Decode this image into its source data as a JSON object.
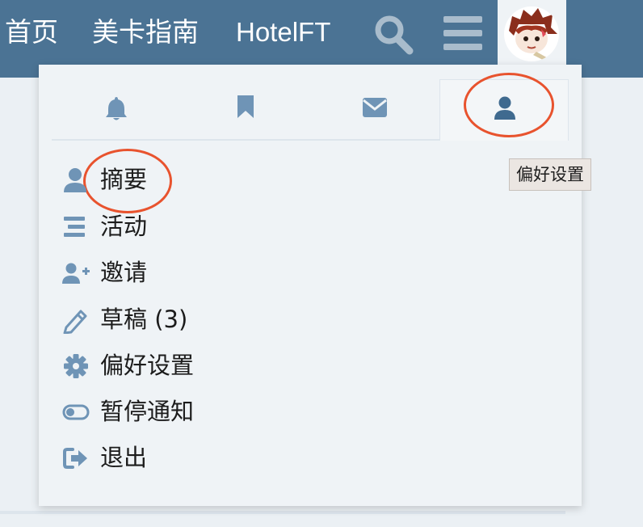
{
  "colors": {
    "header_bg": "#4b7394",
    "panel_bg": "#eff3f6",
    "icon_color": "#6f94b6",
    "active_icon_color": "#3f6a8f",
    "annotation_red": "#e8532e"
  },
  "header": {
    "nav_links": [
      {
        "label": "首页"
      },
      {
        "label": "美卡指南"
      },
      {
        "label": "HotelFT"
      }
    ],
    "icons": [
      "search-icon",
      "hamburger-menu-icon",
      "user-avatar"
    ]
  },
  "user_menu": {
    "tabs": [
      {
        "icon": "bell-icon",
        "active": false
      },
      {
        "icon": "bookmark-icon",
        "active": false
      },
      {
        "icon": "envelope-icon",
        "active": false
      },
      {
        "icon": "user-icon",
        "active": true
      }
    ],
    "tooltip": "偏好设置",
    "items": [
      {
        "icon": "user-icon",
        "label": "摘要"
      },
      {
        "icon": "activity-bars-icon",
        "label": "活动"
      },
      {
        "icon": "user-plus-icon",
        "label": "邀请"
      },
      {
        "icon": "pencil-icon",
        "label": "草稿 (3)"
      },
      {
        "icon": "gear-icon",
        "label": "偏好设置"
      },
      {
        "icon": "toggle-off-icon",
        "label": "暂停通知"
      },
      {
        "icon": "sign-out-icon",
        "label": "退出"
      }
    ]
  }
}
